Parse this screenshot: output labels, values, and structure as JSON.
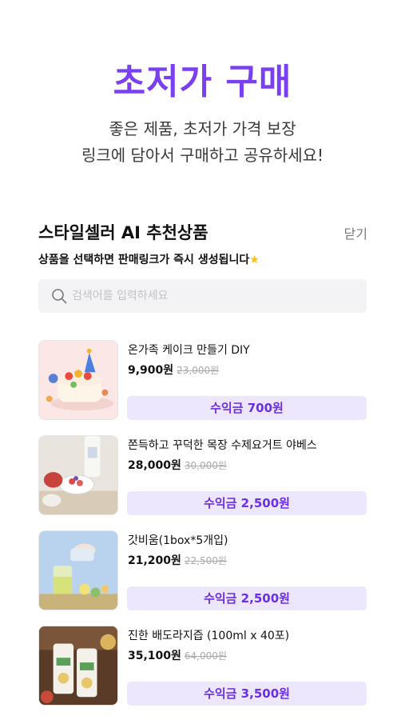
{
  "hero": {
    "title": "초저가 구매",
    "subtitle_line1": "좋은 제품, 초저가 가격 보장",
    "subtitle_line2": "링크에 담아서 구매하고 공유하세요!"
  },
  "section": {
    "title": "스타일셀러 AI 추천상품",
    "close_label": "닫기",
    "description": "상품을 선택하면 판매링크가 즉시 생성됩니다",
    "description_icon": "star-emoji"
  },
  "search": {
    "placeholder": "검색어를 입력하세요",
    "value": "",
    "icon": "search-icon"
  },
  "products": [
    {
      "name": "온가족 케이크 만들기 DIY",
      "price": "9,900원",
      "original_price": "23,000원",
      "profit": "수익금 700원",
      "thumbnail": "cake-image"
    },
    {
      "name": "쫀득하고 꾸덕한 목장 수제요거트 야베스",
      "price": "28,000원",
      "original_price": "30,000원",
      "profit": "수익금 2,500원",
      "thumbnail": "yogurt-image"
    },
    {
      "name": "갓비움(1box*5개입)",
      "price": "21,200원",
      "original_price": "22,500원",
      "profit": "수익금 2,500원",
      "thumbnail": "drink-image"
    },
    {
      "name": "진한 배도라지즙 (100ml x 40포)",
      "price": "35,100원",
      "original_price": "64,000원",
      "profit": "수익금 3,500원",
      "thumbnail": "pear-juice-image"
    }
  ],
  "colors": {
    "accent": "#7a3ff0",
    "profit_bg": "#ede7fd",
    "profit_text": "#6a2fe6",
    "search_bg": "#f3f3f6"
  }
}
